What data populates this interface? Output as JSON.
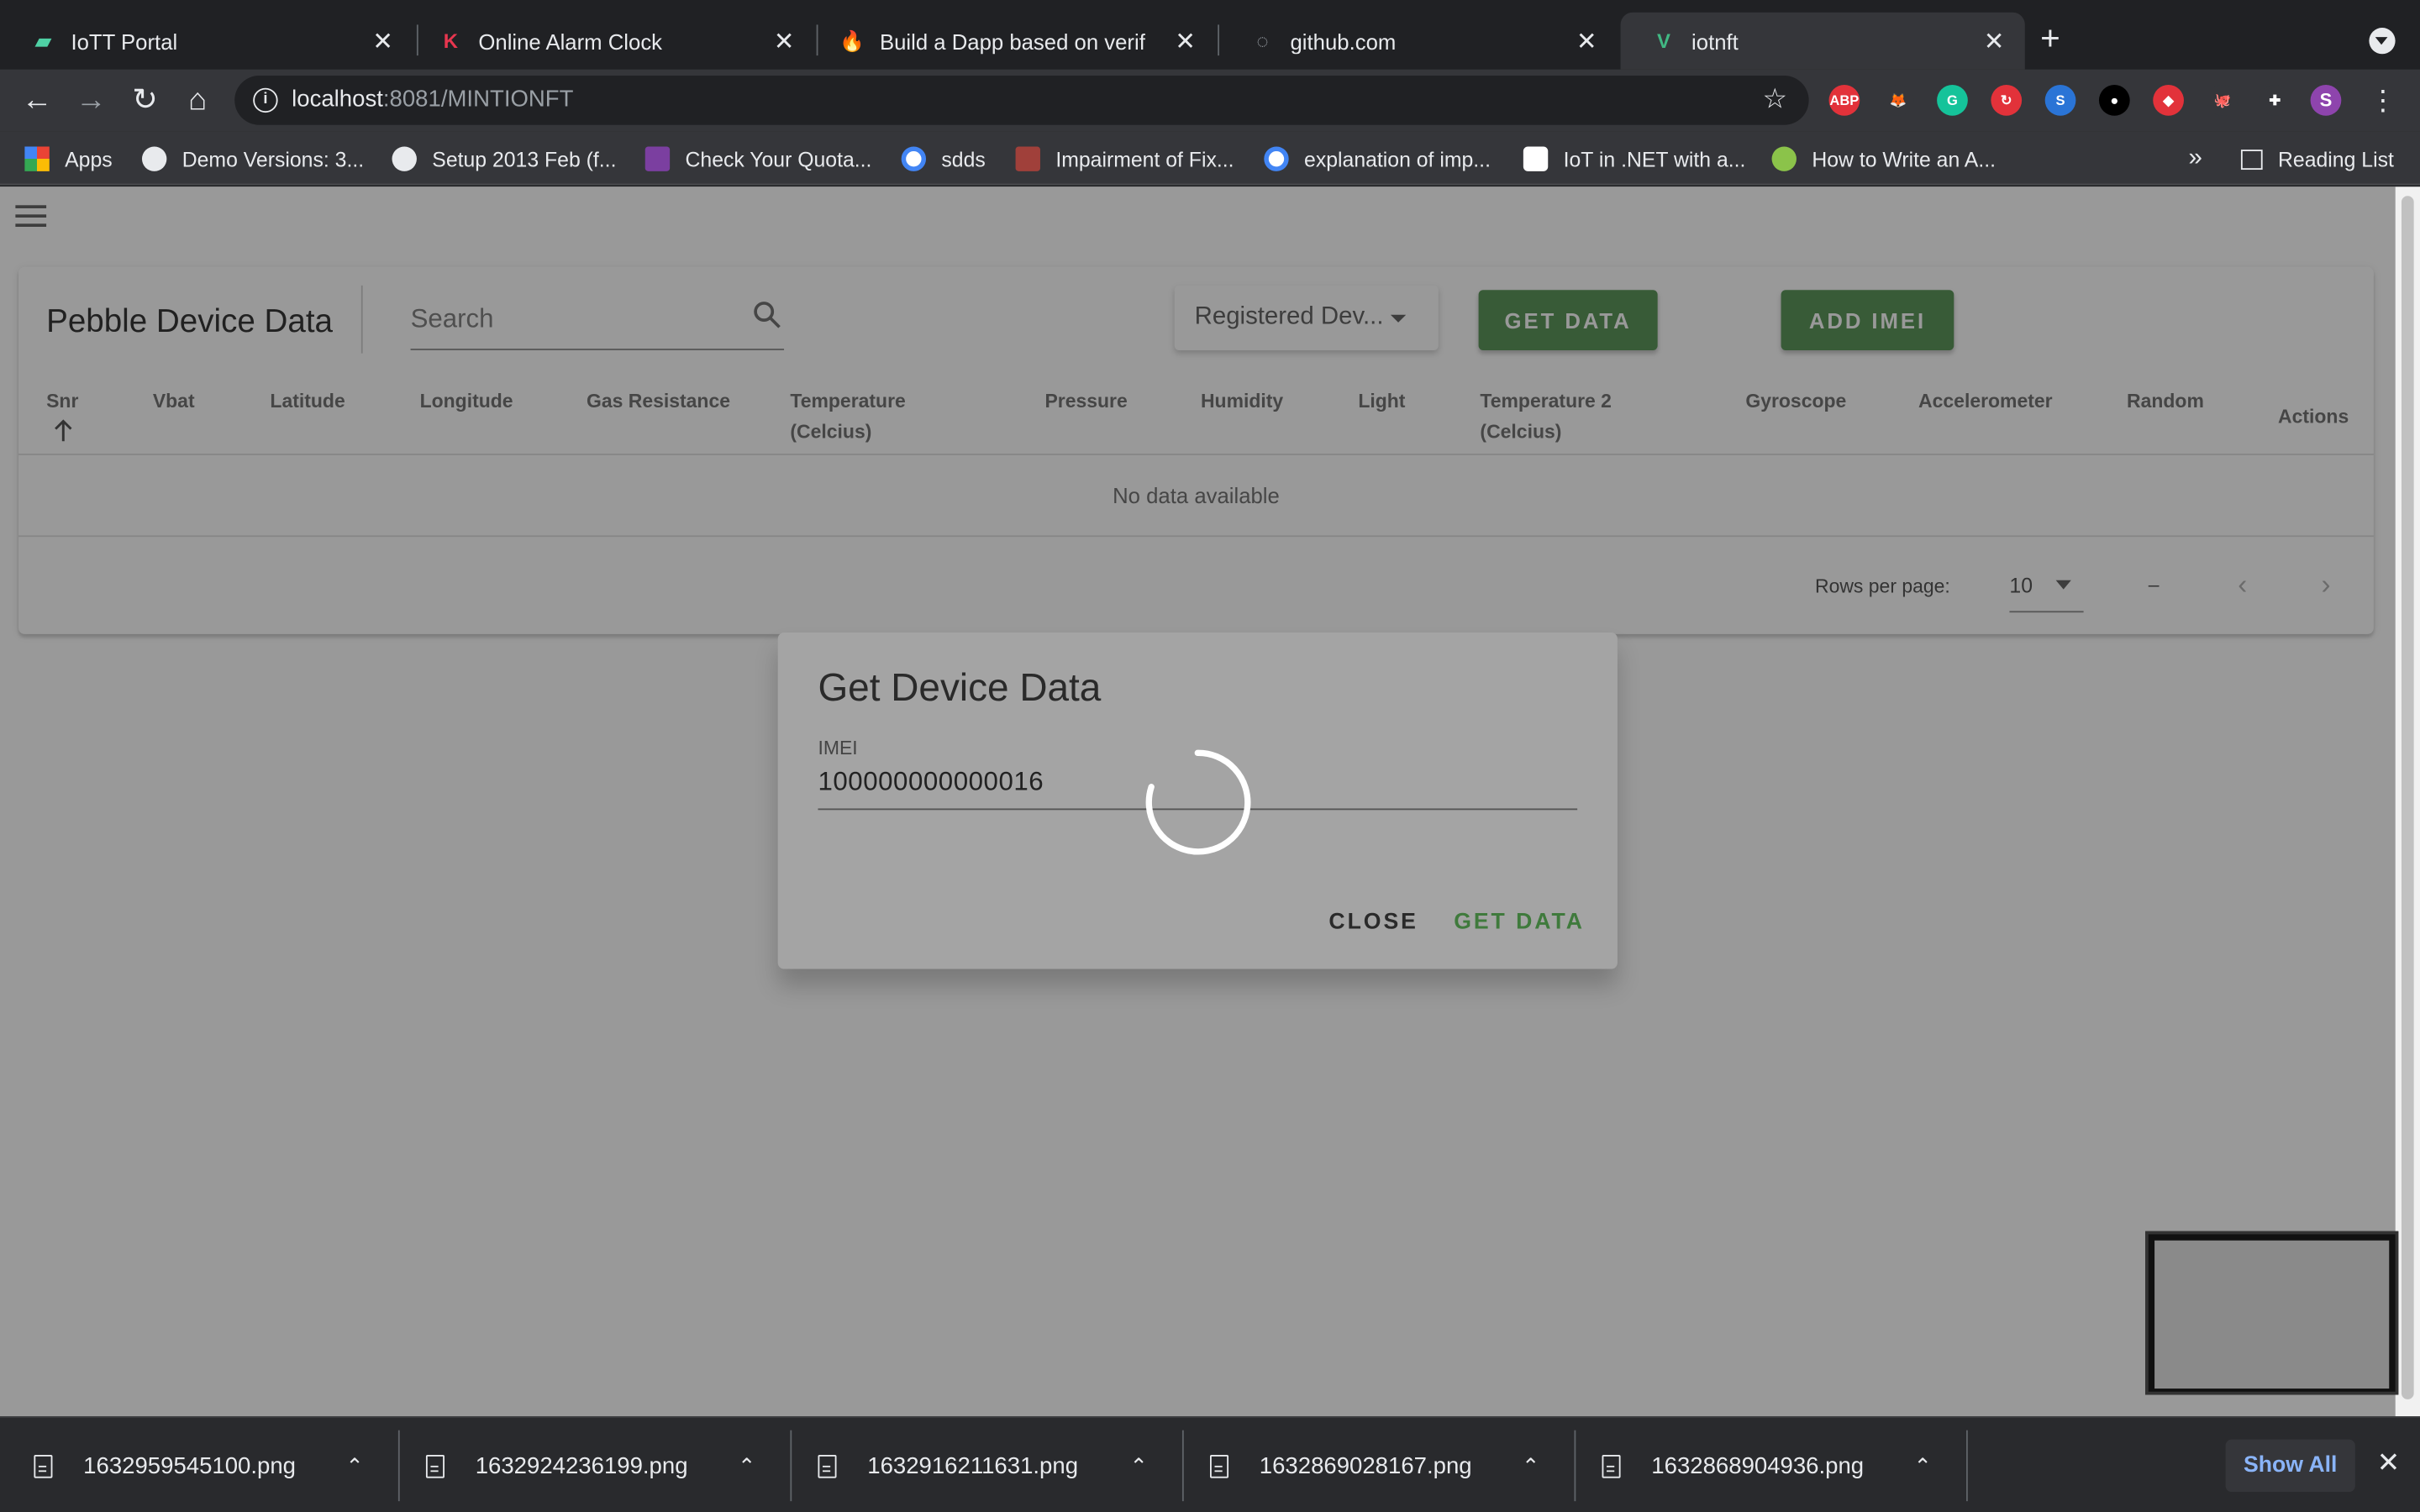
{
  "browser": {
    "tabs": [
      {
        "title": "IoTT Portal",
        "icon": "iott-portal-icon",
        "color": "#4fd1a5",
        "glyph": "▰"
      },
      {
        "title": "Online Alarm Clock",
        "icon": "alarm-clock-k-icon",
        "color": "#e8364f",
        "glyph": "K"
      },
      {
        "title": "Build a Dapp based on verif",
        "icon": "fire-icon",
        "color": "#ff9800",
        "glyph": "🔥"
      },
      {
        "title": "github.com",
        "icon": "loading-icon",
        "color": "#9aa0a6",
        "glyph": "◌"
      },
      {
        "title": "iotnft",
        "icon": "vue-icon",
        "color": "#41b883",
        "glyph": "V"
      }
    ],
    "url_host": "localhost",
    "url_rest": ":8081/MINTIONFT",
    "bookmarks": [
      {
        "label": "Apps",
        "icon": "apps-grid-icon"
      },
      {
        "label": "Demo Versions: 3...",
        "icon": "globe-icon"
      },
      {
        "label": "Setup 2013 Feb (f...",
        "icon": "globe-icon"
      },
      {
        "label": "Check Your Quota...",
        "icon": "shield-icon"
      },
      {
        "label": "sdds",
        "icon": "google-icon"
      },
      {
        "label": "Impairment of Fix...",
        "icon": "book-icon"
      },
      {
        "label": "explanation of imp...",
        "icon": "google-icon"
      },
      {
        "label": "IoT in .NET with a...",
        "icon": "medium-icon"
      },
      {
        "label": "How to Write an A...",
        "icon": "circle-icon"
      }
    ],
    "bookmarks_overflow": "»",
    "reading_list": "Reading List",
    "profile_initial": "S",
    "extensions": [
      {
        "label": "ABP",
        "color": "#e2323a"
      },
      {
        "label": "🦊",
        "color": "#35363a"
      },
      {
        "label": "G",
        "color": "#15c39a"
      },
      {
        "label": "↻",
        "color": "#e2323a"
      },
      {
        "label": "S",
        "color": "#2a74d6"
      },
      {
        "label": "●",
        "color": "#000000"
      },
      {
        "label": "◆",
        "color": "#e2323a"
      },
      {
        "label": "🐙",
        "color": "#35363a"
      },
      {
        "label": "✚",
        "color": "#35363a"
      }
    ]
  },
  "app": {
    "card_title": "Pebble Device Data",
    "search_placeholder": "Search",
    "select_value": "Registered Dev...",
    "get_data_button": "GET DATA",
    "add_imei_button": "ADD IMEI",
    "columns": [
      {
        "label": "Snr",
        "label2": ""
      },
      {
        "label": "Vbat",
        "label2": ""
      },
      {
        "label": "Latitude",
        "label2": ""
      },
      {
        "label": "Longitude",
        "label2": ""
      },
      {
        "label": "Gas Resistance",
        "label2": ""
      },
      {
        "label": "Temperature",
        "label2": "(Celcius)"
      },
      {
        "label": "Pressure",
        "label2": ""
      },
      {
        "label": "Humidity",
        "label2": ""
      },
      {
        "label": "Light",
        "label2": ""
      },
      {
        "label": "Temperature 2",
        "label2": "(Celcius)"
      },
      {
        "label": "Gyroscope",
        "label2": ""
      },
      {
        "label": "Accelerometer",
        "label2": ""
      },
      {
        "label": "Random",
        "label2": ""
      },
      {
        "label": "Actions",
        "label2": ""
      }
    ],
    "no_data": "No data available",
    "rows_per_page_label": "Rows per page:",
    "rows_per_page_value": "10",
    "page_range": "–",
    "accent_color": "#4c8c4a"
  },
  "dialog": {
    "title": "Get Device Data",
    "field_label": "IMEI",
    "field_value": "100000000000016",
    "close_button": "CLOSE",
    "get_data_button": "GET DATA"
  },
  "downloads": {
    "files": [
      "1632959545100.png",
      "1632924236199.png",
      "1632916211631.png",
      "1632869028167.png",
      "1632868904936.png"
    ],
    "show_all": "Show All"
  }
}
